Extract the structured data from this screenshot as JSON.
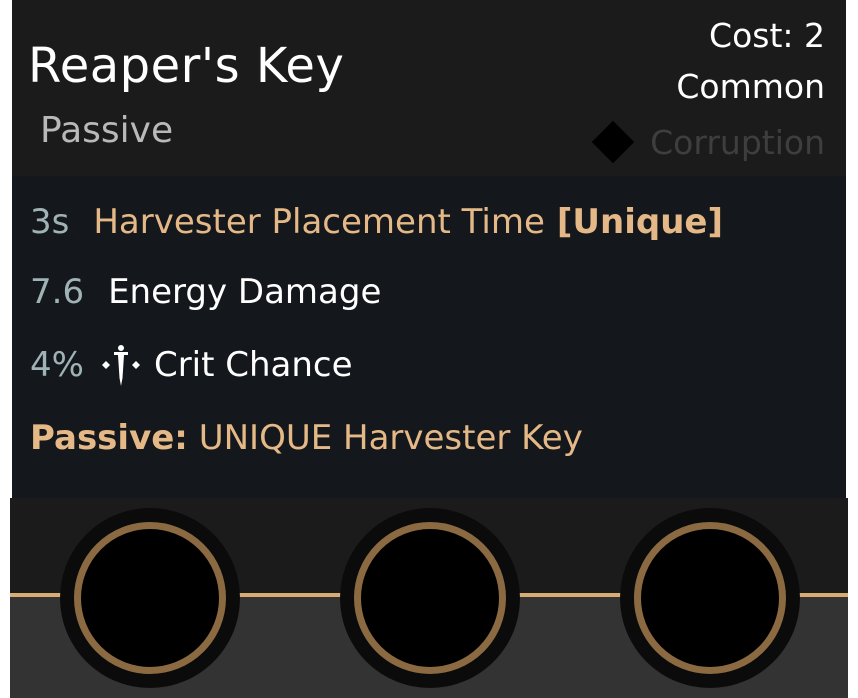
{
  "card": {
    "title": "Reaper's Key",
    "subtype": "Passive",
    "cost": "Cost: 2",
    "rarity": "Common",
    "corruption_label": "Corruption"
  },
  "stats": [
    {
      "value": "3s",
      "label": "Harvester Placement Time",
      "tag": "[Unique]"
    },
    {
      "value": "7.6",
      "label": "Energy Damage"
    },
    {
      "value": "4%",
      "label": "Crit Chance",
      "icon": "crit-icon"
    }
  ],
  "passive": {
    "prefix": "Passive:",
    "text": "UNIQUE Harvester Key"
  },
  "colors": {
    "gold": "#e5b987",
    "stat_value": "#9fb3b6",
    "ring": "#8b6a42"
  },
  "sockets": 3
}
